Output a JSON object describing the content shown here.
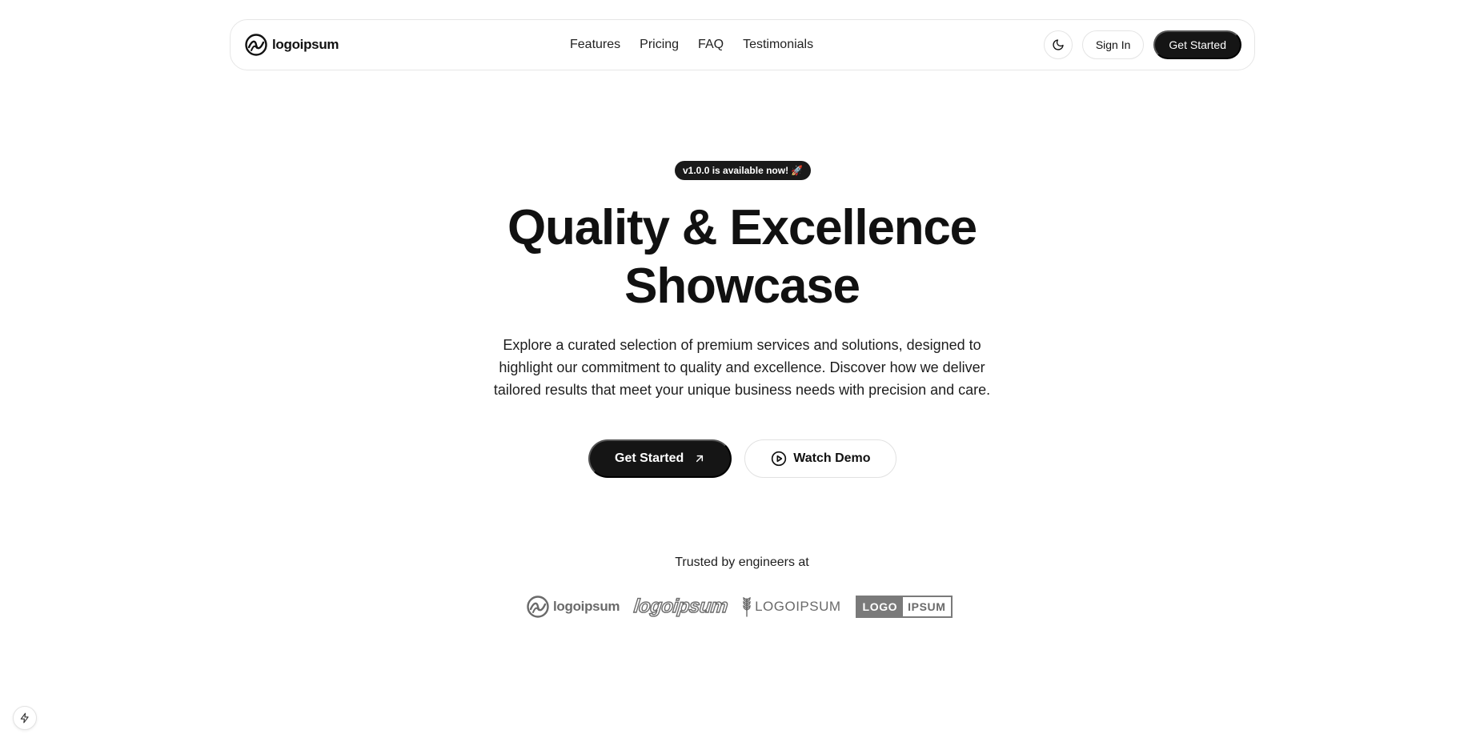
{
  "header": {
    "brand_name": "logoipsum",
    "brand_icon": "logoipsum-swirl-icon",
    "nav": [
      {
        "label": "Features"
      },
      {
        "label": "Pricing"
      },
      {
        "label": "FAQ"
      },
      {
        "label": "Testimonials"
      }
    ],
    "theme_toggle_icon": "moon-icon",
    "sign_in_label": "Sign In",
    "get_started_label": "Get Started"
  },
  "hero": {
    "badge": "v1.0.0 is available now! 🚀",
    "title_line1": "Quality & Excellence",
    "title_line2": "Showcase",
    "description": "Explore a curated selection of premium services and solutions, designed to highlight our commitment to quality and excellence. Discover how we deliver tailored results that meet your unique business needs with precision and care.",
    "primary_cta": "Get Started",
    "primary_cta_icon": "arrow-up-right-icon",
    "secondary_cta": "Watch Demo",
    "secondary_cta_icon": "play-circle-icon"
  },
  "trusted": {
    "heading": "Trusted by engineers at",
    "logos": [
      {
        "text": "logoipsum",
        "icon": "logoipsum-swirl-icon"
      },
      {
        "text": "logoipsum",
        "icon": "logoipsum-script-logo"
      },
      {
        "text": "LOGOIPSUM",
        "icon": "wheat-icon"
      },
      {
        "text_left": "LOGO",
        "text_right": "IPSUM"
      }
    ]
  },
  "corner_widget_icon": "lightning-icon",
  "colors": {
    "primary": "#151515",
    "border": "#e6e6e6",
    "logo_gray": "#6a6a6a"
  }
}
